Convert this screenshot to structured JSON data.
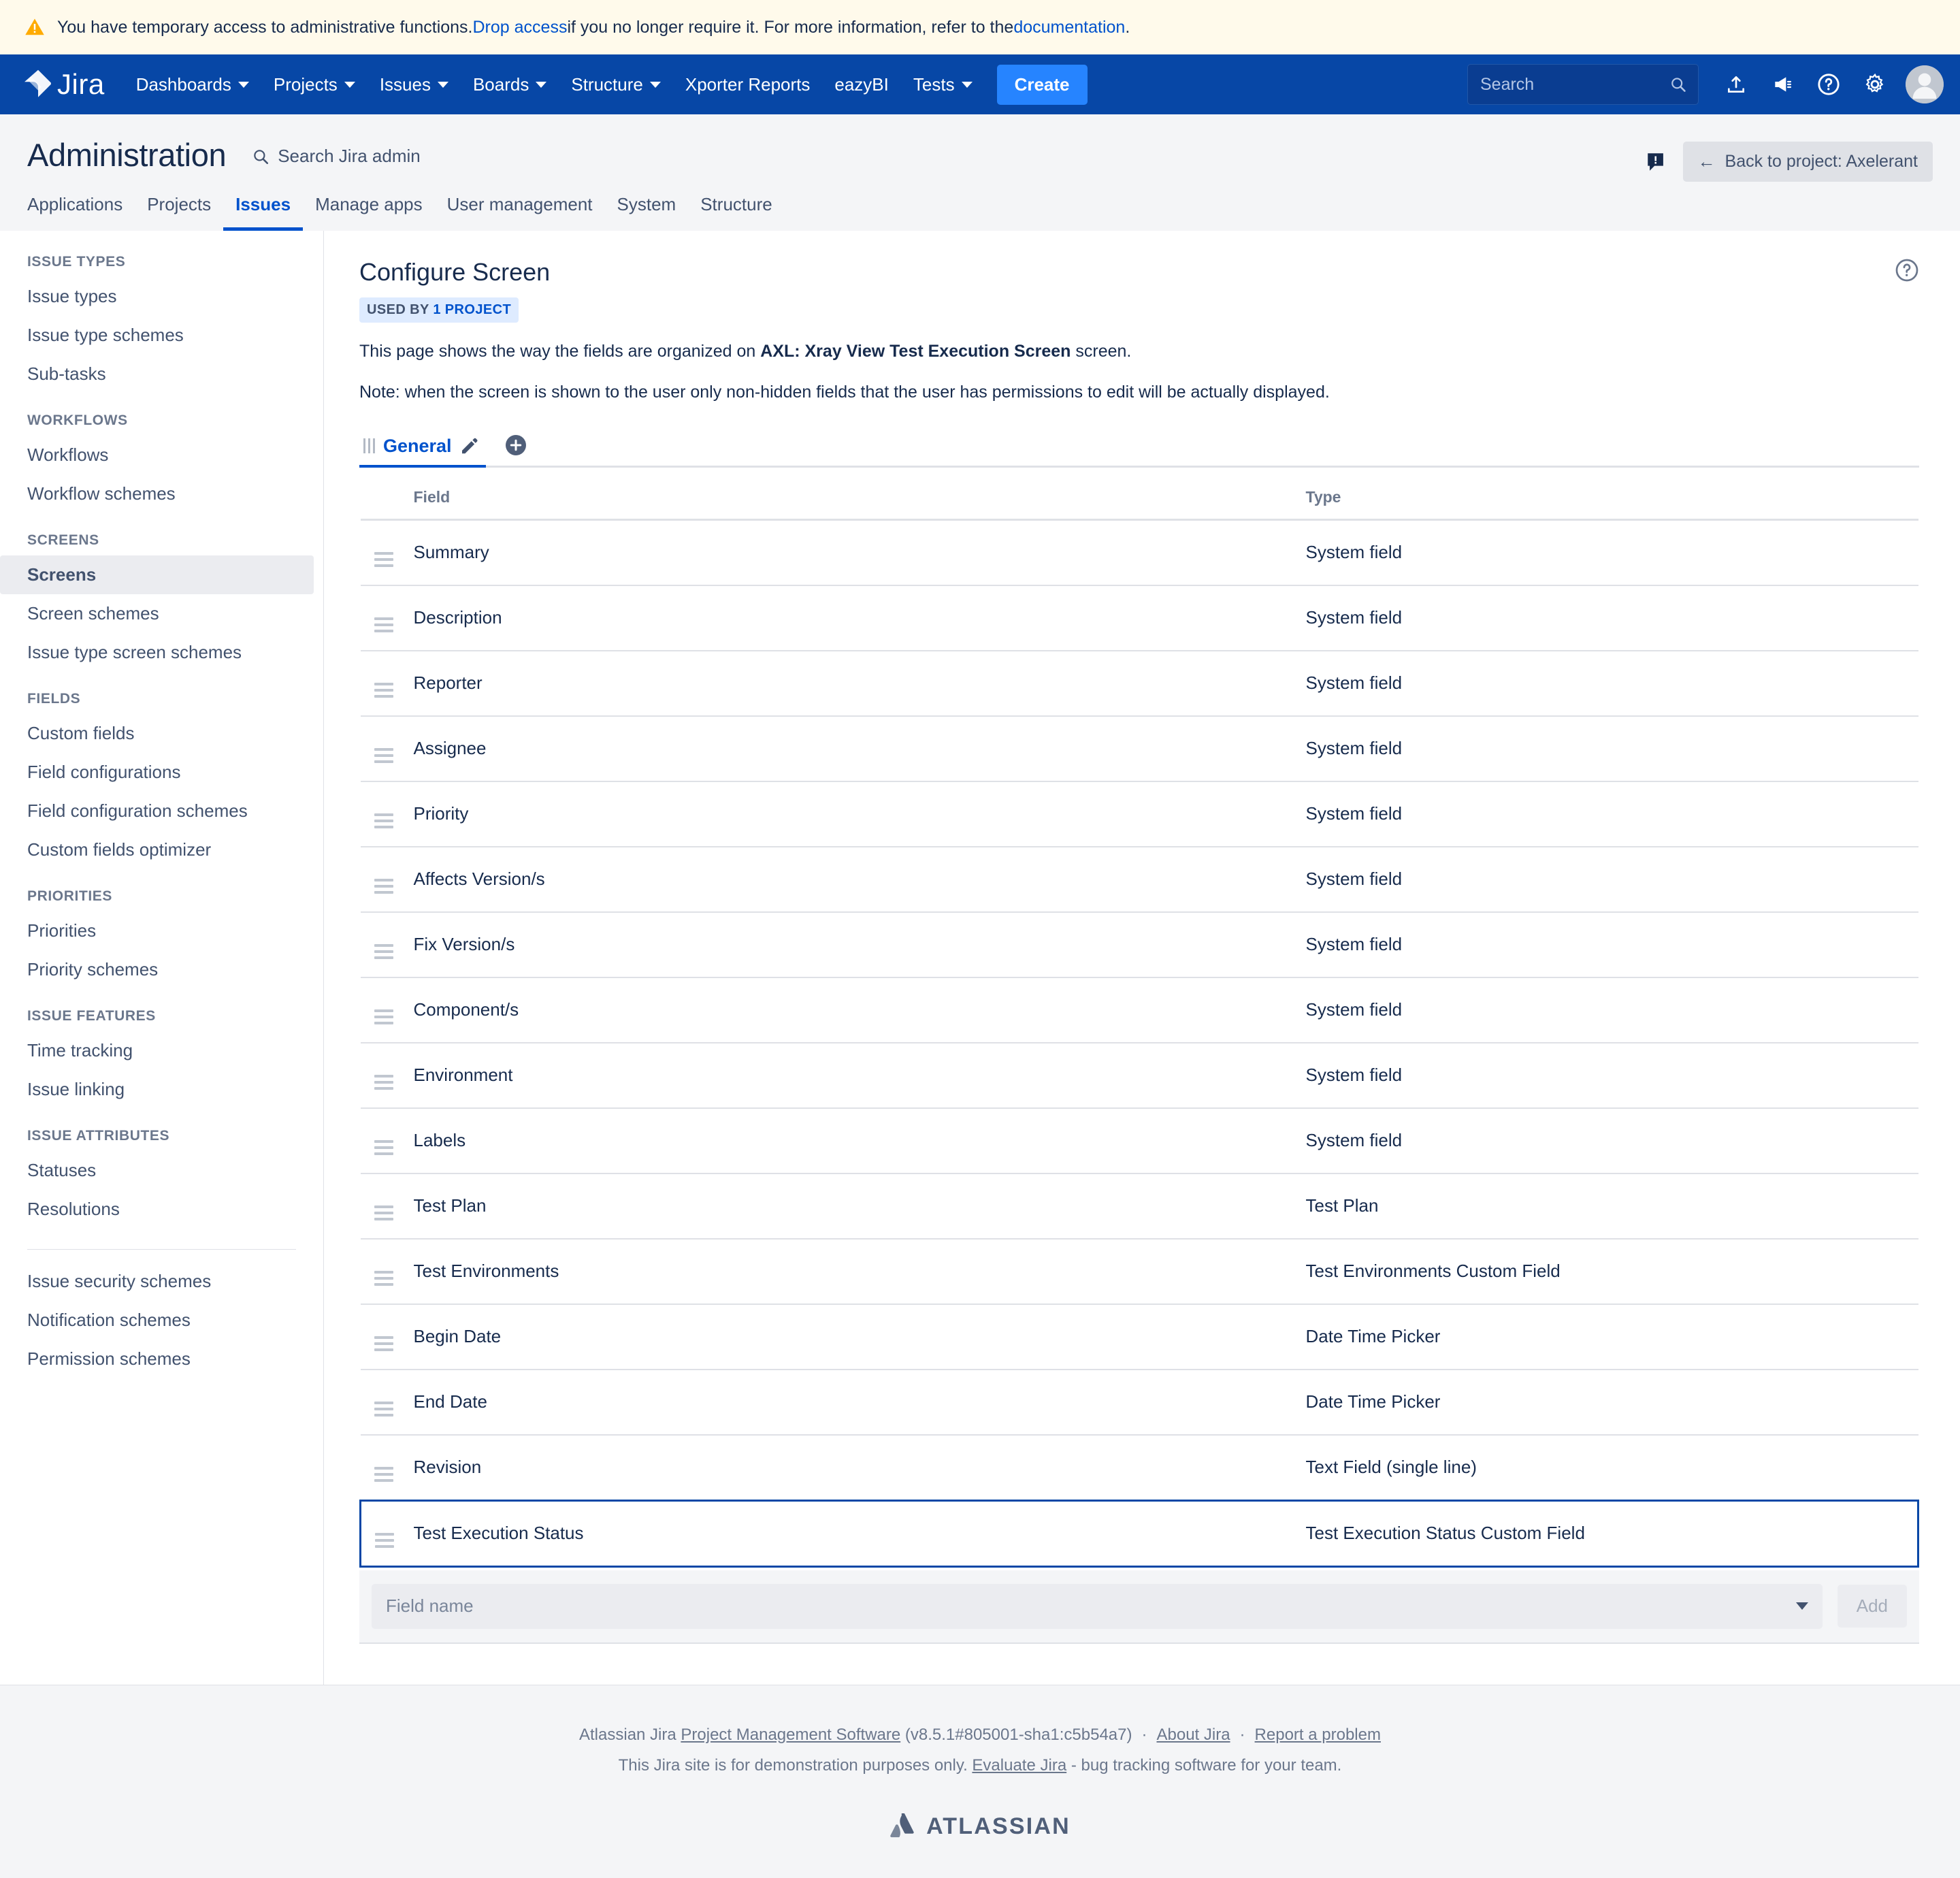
{
  "admin_banner": {
    "icon": "warning-icon",
    "text_before": "You have temporary access to administrative functions. ",
    "link_drop": "Drop access",
    "text_middle": " if you no longer require it. For more information, refer to the ",
    "link_docs": "documentation",
    "text_after": "."
  },
  "topnav": {
    "logo_text": "Jira",
    "items": [
      {
        "label": "Dashboards",
        "has_chevron": true
      },
      {
        "label": "Projects",
        "has_chevron": true
      },
      {
        "label": "Issues",
        "has_chevron": true
      },
      {
        "label": "Boards",
        "has_chevron": true
      },
      {
        "label": "Structure",
        "has_chevron": true
      },
      {
        "label": "Xporter Reports",
        "has_chevron": false
      },
      {
        "label": "eazyBI",
        "has_chevron": false
      },
      {
        "label": "Tests",
        "has_chevron": true
      }
    ],
    "create_label": "Create",
    "search_placeholder": "Search",
    "search_value": "",
    "icons": [
      "import-icon",
      "announcement-icon",
      "help-icon",
      "settings-icon",
      "avatar"
    ]
  },
  "admin_header": {
    "title": "Administration",
    "search_label": "Search Jira admin",
    "feedback_icon": "feedback-icon",
    "back_button": "Back to project: Axelerant",
    "back_arrow": "←"
  },
  "admin_tabs": [
    {
      "label": "Applications",
      "active": false
    },
    {
      "label": "Projects",
      "active": false
    },
    {
      "label": "Issues",
      "active": true
    },
    {
      "label": "Manage apps",
      "active": false
    },
    {
      "label": "User management",
      "active": false
    },
    {
      "label": "System",
      "active": false
    },
    {
      "label": "Structure",
      "active": false
    }
  ],
  "sidebar": {
    "groups": [
      {
        "title": "ISSUE TYPES",
        "items": [
          {
            "label": "Issue types",
            "active": false
          },
          {
            "label": "Issue type schemes",
            "active": false
          },
          {
            "label": "Sub-tasks",
            "active": false
          }
        ]
      },
      {
        "title": "WORKFLOWS",
        "items": [
          {
            "label": "Workflows",
            "active": false
          },
          {
            "label": "Workflow schemes",
            "active": false
          }
        ]
      },
      {
        "title": "SCREENS",
        "items": [
          {
            "label": "Screens",
            "active": true
          },
          {
            "label": "Screen schemes",
            "active": false
          },
          {
            "label": "Issue type screen schemes",
            "active": false
          }
        ]
      },
      {
        "title": "FIELDS",
        "items": [
          {
            "label": "Custom fields",
            "active": false
          },
          {
            "label": "Field configurations",
            "active": false
          },
          {
            "label": "Field configuration schemes",
            "active": false
          },
          {
            "label": "Custom fields optimizer",
            "active": false
          }
        ]
      },
      {
        "title": "PRIORITIES",
        "items": [
          {
            "label": "Priorities",
            "active": false
          },
          {
            "label": "Priority schemes",
            "active": false
          }
        ]
      },
      {
        "title": "ISSUE FEATURES",
        "items": [
          {
            "label": "Time tracking",
            "active": false
          },
          {
            "label": "Issue linking",
            "active": false
          }
        ]
      },
      {
        "title": "ISSUE ATTRIBUTES",
        "items": [
          {
            "label": "Statuses",
            "active": false
          },
          {
            "label": "Resolutions",
            "active": false
          }
        ]
      }
    ],
    "extra_items": [
      {
        "label": "Issue security schemes",
        "active": false
      },
      {
        "label": "Notification schemes",
        "active": false
      },
      {
        "label": "Permission schemes",
        "active": false
      }
    ]
  },
  "main": {
    "page_title": "Configure Screen",
    "help_icon": "help-circle-icon",
    "lozenge_prefix": "USED BY ",
    "lozenge_link": "1 PROJECT",
    "desc_prefix": "This page shows the way the fields are organized on ",
    "desc_screen_name": "AXL: Xray View Test Execution Screen",
    "desc_suffix": " screen.",
    "note": "Note: when the screen is shown to the user only non-hidden fields that the user has permissions to edit will be actually displayed.",
    "screen_tab_label": "General",
    "edit_icon": "pencil-icon",
    "add_tab_icon": "plus-circle-icon",
    "table": {
      "headers": [
        "Field",
        "Type"
      ],
      "rows": [
        {
          "field": "Summary",
          "type": "System field",
          "selected": false
        },
        {
          "field": "Description",
          "type": "System field",
          "selected": false
        },
        {
          "field": "Reporter",
          "type": "System field",
          "selected": false
        },
        {
          "field": "Assignee",
          "type": "System field",
          "selected": false
        },
        {
          "field": "Priority",
          "type": "System field",
          "selected": false
        },
        {
          "field": "Affects Version/s",
          "type": "System field",
          "selected": false
        },
        {
          "field": "Fix Version/s",
          "type": "System field",
          "selected": false
        },
        {
          "field": "Component/s",
          "type": "System field",
          "selected": false
        },
        {
          "field": "Environment",
          "type": "System field",
          "selected": false
        },
        {
          "field": "Labels",
          "type": "System field",
          "selected": false
        },
        {
          "field": "Test Plan",
          "type": "Test Plan",
          "selected": false
        },
        {
          "field": "Test Environments",
          "type": "Test Environments Custom Field",
          "selected": false
        },
        {
          "field": "Begin Date",
          "type": "Date Time Picker",
          "selected": false
        },
        {
          "field": "End Date",
          "type": "Date Time Picker",
          "selected": false
        },
        {
          "field": "Revision",
          "type": "Text Field (single line)",
          "selected": false
        },
        {
          "field": "Test Execution Status",
          "type": "Test Execution Status Custom Field",
          "selected": true
        }
      ]
    },
    "add_field": {
      "placeholder": "Field name",
      "value": "",
      "add_label": "Add"
    }
  },
  "footer": {
    "line1_prefix": "Atlassian Jira ",
    "line1_link": "Project Management Software",
    "line1_version": " (v8.5.1#805001-sha1:c5b54a7)",
    "about_link": "About Jira",
    "report_link": "Report a problem",
    "separator": "·",
    "line2_prefix": "This Jira site is for demonstration purposes only. ",
    "line2_link": "Evaluate Jira",
    "line2_suffix": " - bug tracking software for your team.",
    "brand": "ATLASSIAN"
  }
}
